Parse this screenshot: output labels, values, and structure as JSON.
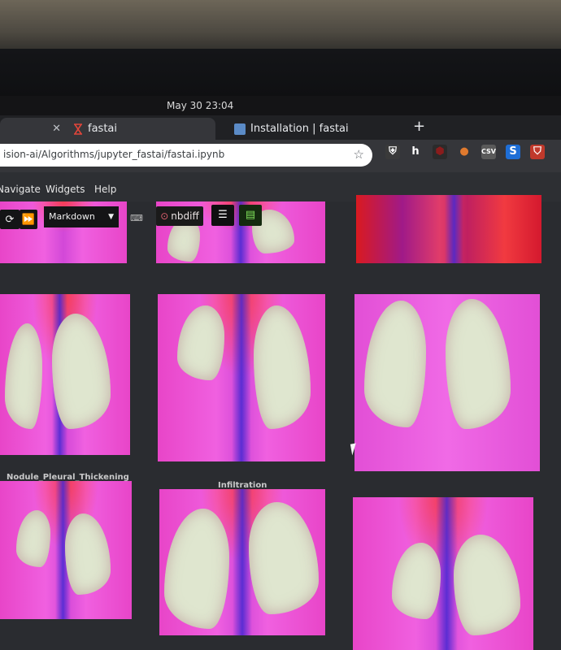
{
  "system": {
    "clock": "May 30  23:04"
  },
  "tabs": [
    {
      "title": "fastai",
      "favicon": "hourglass-icon",
      "active": true
    },
    {
      "title": "Installation | fastai",
      "favicon": "doc-icon",
      "active": false
    }
  ],
  "address": {
    "url": "ision-ai/Algorithms/jupyter_fastai/fastai.ipynb"
  },
  "extensions": [
    "shield-icon",
    "h-icon",
    "block-icon",
    "cookie-icon",
    "csv-icon",
    "s-icon",
    "ublock-icon"
  ],
  "menu": {
    "items": [
      "Navigate",
      "Widgets",
      "Help"
    ]
  },
  "toolbar": {
    "cell_type": "Markdown",
    "nbdiff_label": "nbdiff"
  },
  "tiles": {
    "label_nodule": "Nodule_Pleural_Thickening",
    "label_infiltration": "Infiltration"
  },
  "colors": {
    "xray_magenta": "#e845c8",
    "xray_blue": "#4628d2",
    "jupyter_dark": "#2a2c30"
  }
}
